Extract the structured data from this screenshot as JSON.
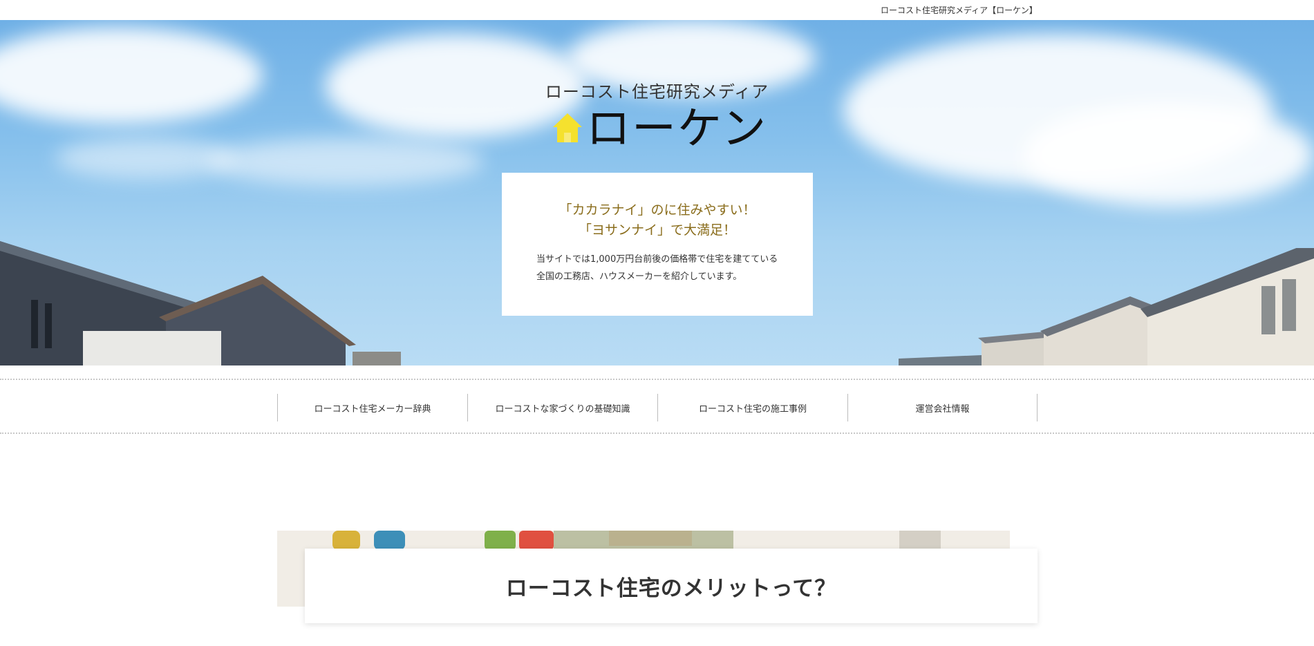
{
  "topbar": {
    "text": "ローコスト住宅研究メディア【ローケン】"
  },
  "hero": {
    "subtitle": "ローコスト住宅研究メディア",
    "logo": "ローケン",
    "catch_lines": [
      "「カカラナイ」のに住みやすい！",
      "「ヨサンナイ」で大満足！"
    ],
    "description": "当サイトでは1,000万円台前後の価格帯で住宅を建てている全国の工務店、ハウスメーカーを紹介しています。"
  },
  "nav": {
    "items": [
      "ローコスト住宅メーカー辞典",
      "ローコストな家づくりの基礎知識",
      "ローコスト住宅の施工事例",
      "運営会社情報"
    ]
  },
  "section": {
    "title": "ローコスト住宅のメリットって？"
  },
  "colors": {
    "accent": "#f5e12e",
    "catch": "#8a6d1c",
    "sky": "#86c0ec"
  },
  "icons": {
    "logo": "house-icon"
  }
}
